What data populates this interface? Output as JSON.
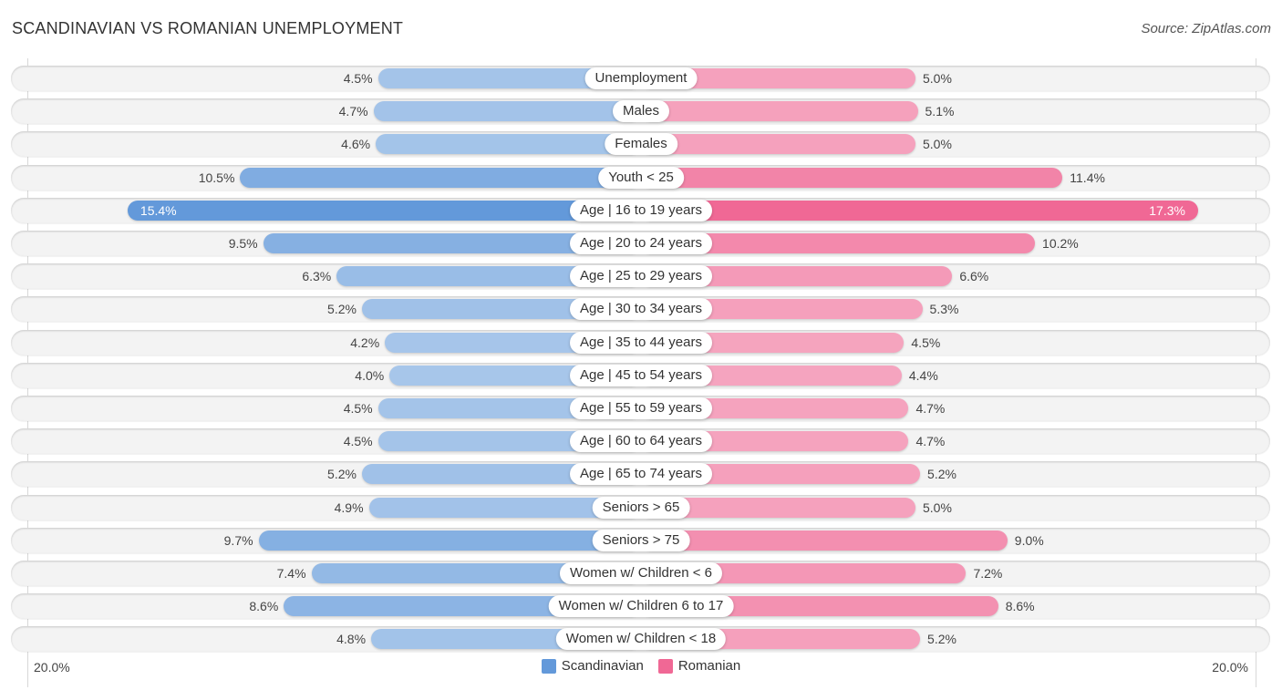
{
  "header": {
    "title": "SCANDINAVIAN VS ROMANIAN UNEMPLOYMENT",
    "source": "Source: ZipAtlas.com"
  },
  "colors": {
    "scandinavian_strong": "#6399da",
    "scandinavian_light": "#a7c6ea",
    "romanian_strong": "#f06895",
    "romanian_light": "#f5a6c0"
  },
  "chart_data": {
    "type": "bar",
    "orientation": "horizontal-diverging",
    "title": "SCANDINAVIAN VS ROMANIAN UNEMPLOYMENT",
    "xlabel": "",
    "ylabel": "",
    "xlim": [
      0,
      20.0
    ],
    "axis_labels": {
      "left": "20.0%",
      "right": "20.0%"
    },
    "legend_position": "bottom-center",
    "categories": [
      "Unemployment",
      "Males",
      "Females",
      "Youth < 25",
      "Age | 16 to 19 years",
      "Age | 20 to 24 years",
      "Age | 25 to 29 years",
      "Age | 30 to 34 years",
      "Age | 35 to 44 years",
      "Age | 45 to 54 years",
      "Age | 55 to 59 years",
      "Age | 60 to 64 years",
      "Age | 65 to 74 years",
      "Seniors > 65",
      "Seniors > 75",
      "Women w/ Children < 6",
      "Women w/ Children 6 to 17",
      "Women w/ Children < 18"
    ],
    "series": [
      {
        "name": "Scandinavian",
        "side": "left",
        "values": [
          4.5,
          4.7,
          4.6,
          10.5,
          15.4,
          9.5,
          6.3,
          5.2,
          4.2,
          4.0,
          4.5,
          4.5,
          5.2,
          4.9,
          9.7,
          7.4,
          8.6,
          4.8
        ],
        "labels": [
          "4.5%",
          "4.7%",
          "4.6%",
          "10.5%",
          "15.4%",
          "9.5%",
          "6.3%",
          "5.2%",
          "4.2%",
          "4.0%",
          "4.5%",
          "4.5%",
          "5.2%",
          "4.9%",
          "9.7%",
          "7.4%",
          "8.6%",
          "4.8%"
        ]
      },
      {
        "name": "Romanian",
        "side": "right",
        "values": [
          5.0,
          5.1,
          5.0,
          11.4,
          17.3,
          10.2,
          6.6,
          5.3,
          4.5,
          4.4,
          4.7,
          4.7,
          5.2,
          5.0,
          9.0,
          7.2,
          8.6,
          5.2
        ],
        "labels": [
          "5.0%",
          "5.1%",
          "5.0%",
          "11.4%",
          "17.3%",
          "10.2%",
          "6.6%",
          "5.3%",
          "4.5%",
          "4.4%",
          "4.7%",
          "4.7%",
          "5.2%",
          "5.0%",
          "9.0%",
          "7.2%",
          "8.6%",
          "5.2%"
        ]
      }
    ]
  },
  "legend": {
    "items": [
      {
        "label": "Scandinavian"
      },
      {
        "label": "Romanian"
      }
    ]
  }
}
